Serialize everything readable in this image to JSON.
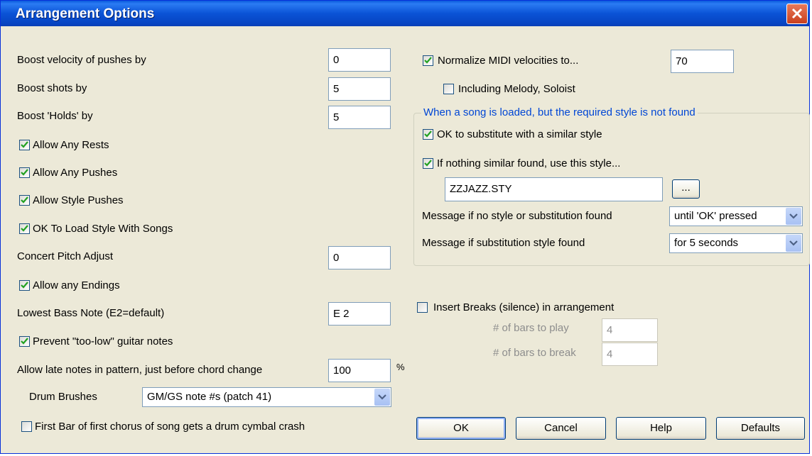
{
  "window": {
    "title": "Arrangement Options"
  },
  "left": {
    "boost_pushes": {
      "label": "Boost velocity of pushes by",
      "value": "0"
    },
    "boost_shots": {
      "label": "Boost shots by",
      "value": "5"
    },
    "boost_holds": {
      "label": "Boost 'Holds' by",
      "value": "5"
    },
    "allow_rests": {
      "label": "Allow Any Rests",
      "checked": true
    },
    "allow_pushes": {
      "label": "Allow Any Pushes",
      "checked": true
    },
    "allow_style_pushes": {
      "label": "Allow Style Pushes",
      "checked": true
    },
    "ok_load_style": {
      "label": "OK To Load Style With Songs",
      "checked": true
    },
    "concert_pitch": {
      "label": "Concert Pitch Adjust",
      "value": "0"
    },
    "allow_endings": {
      "label": "Allow any Endings",
      "checked": true
    },
    "lowest_bass": {
      "label": "Lowest Bass Note (E2=default)",
      "value": "E 2"
    },
    "prevent_low_guitar": {
      "label": "Prevent \"too-low\" guitar notes",
      "checked": true
    },
    "late_notes": {
      "label": "Allow late notes in pattern, just before chord change",
      "value": "100",
      "unit": "%"
    },
    "drum_brushes": {
      "label": "Drum Brushes",
      "selected": "GM/GS note #s (patch 41)"
    },
    "cymbal_crash": {
      "label": "First Bar of first chorus of song gets a drum cymbal crash",
      "checked": false
    }
  },
  "right": {
    "normalize": {
      "label": "Normalize MIDI velocities to...",
      "checked": true,
      "value": "70"
    },
    "including_melody": {
      "label": "Including Melody, Soloist",
      "checked": false
    },
    "style_group": {
      "title": "When a song is loaded, but the required style is not found",
      "ok_substitute": {
        "label": "OK to substitute with a similar style",
        "checked": true
      },
      "nothing_similar": {
        "label": "If nothing similar found, use this style...",
        "checked": true
      },
      "style_file": "ZZJAZZ.STY",
      "browse_label": "...",
      "msg_no_style": {
        "label": "Message if no style or substitution found",
        "selected": "until 'OK' pressed"
      },
      "msg_substitution": {
        "label": "Message if substitution style  found",
        "selected": "for 5 seconds"
      }
    },
    "insert_breaks": {
      "label": "Insert Breaks (silence) in arrangement",
      "checked": false
    },
    "bars_to_play": {
      "label": "# of bars to play",
      "value": "4"
    },
    "bars_to_break": {
      "label": "# of bars to break",
      "value": "4"
    }
  },
  "buttons": {
    "ok": "OK",
    "cancel": "Cancel",
    "help": "Help",
    "defaults": "Defaults"
  },
  "colors": {
    "titlebar": "#0a53d6",
    "dialog_bg": "#ece9d8",
    "group_title": "#0046d5",
    "check": "#21a121"
  }
}
